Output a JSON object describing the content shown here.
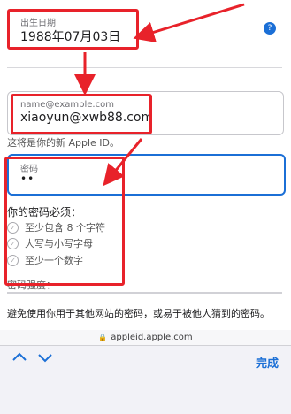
{
  "birthdate": {
    "label": "出生日期",
    "value": "1988年07月03日"
  },
  "help_icon_glyph": "?",
  "email": {
    "placeholder": "name@example.com",
    "value": "xiaoyun@xwb88.com",
    "note": "这将是你的新 Apple ID。"
  },
  "password": {
    "label": "密码",
    "value": "••",
    "rules_title": "你的密码必须：",
    "rules": [
      "至少包含 8 个字符",
      "大写与小写字母",
      "至少一个数字"
    ],
    "strength_label": "密码强度：",
    "advice": "避免使用你用于其他网站的密码，或易于被他人猜到的密码。"
  },
  "browser": {
    "url": "appleid.apple.com",
    "done_label": "完成"
  },
  "colors": {
    "annotation": "#e8222a",
    "accent": "#1b6fd6"
  }
}
